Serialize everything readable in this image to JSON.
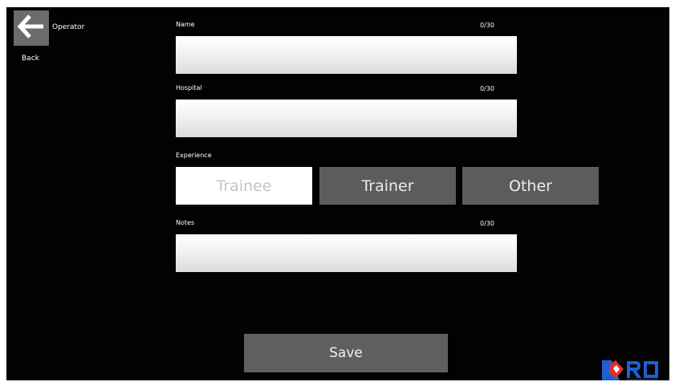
{
  "header": {
    "back_label": "Back",
    "title": "Operator"
  },
  "form": {
    "name": {
      "label": "Name",
      "counter": "0/30",
      "value": ""
    },
    "hospital": {
      "label": "Hospital",
      "counter": "0/30",
      "value": ""
    },
    "experience": {
      "label": "Experience",
      "options": [
        "Trainee",
        "Trainer",
        "Other"
      ],
      "selected": "Trainee"
    },
    "notes": {
      "label": "Notes",
      "counter": "0/30",
      "value": ""
    }
  },
  "actions": {
    "save_label": "Save"
  },
  "colors": {
    "background": "#020202",
    "button_gray": "#5c5c5c",
    "logo_blue": "#1d5fd6",
    "logo_red": "#d9322b"
  }
}
